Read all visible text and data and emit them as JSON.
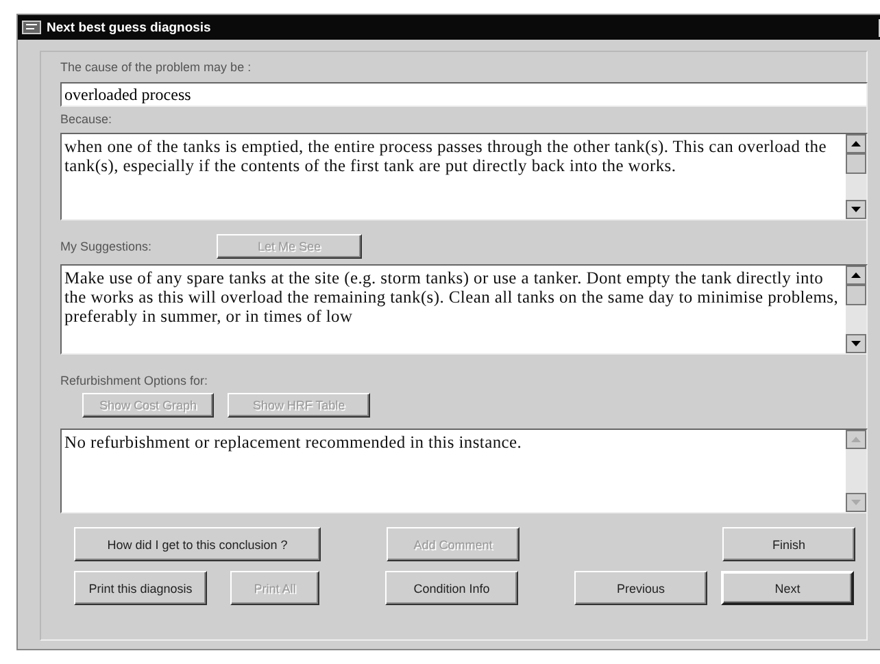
{
  "window": {
    "title": "Next best guess diagnosis"
  },
  "cause": {
    "label": "The cause of the problem may be :",
    "value": "overloaded process"
  },
  "because": {
    "label": "Because:",
    "text": "when one of the tanks is emptied, the entire process passes through the other tank(s). This can overload the tank(s), especially if the contents of the first tank are put directly back into the works.",
    "scroll_disabled": false
  },
  "suggestions": {
    "label": "My Suggestions:",
    "button": {
      "label": "Let Me See",
      "disabled": true
    },
    "text": "Make use of any spare tanks at the site (e.g. storm tanks) or use a tanker. Dont empty the tank directly into the works as this will overload the remaining tank(s). Clean all tanks on the same day to minimise problems, preferably in summer, or in times of low",
    "scroll_disabled": false
  },
  "refurbishment": {
    "label": "Refurbishment Options for:",
    "buttons": [
      {
        "label": "Show Cost Graph",
        "disabled": true
      },
      {
        "label": "Show HRF Table",
        "disabled": true
      }
    ],
    "text": "No refurbishment or replacement recommended in this instance.",
    "scroll_disabled": true
  },
  "buttons_row1": [
    {
      "label": "How did I get to this conclusion ?",
      "disabled": false,
      "default": false
    },
    {
      "label": "Add Comment",
      "disabled": true,
      "default": false
    },
    {
      "label": "Finish",
      "disabled": false,
      "default": false
    }
  ],
  "buttons_row2": [
    {
      "label": "Print this diagnosis",
      "disabled": false,
      "default": false
    },
    {
      "label": "Print All",
      "disabled": true,
      "default": false
    },
    {
      "label": "Condition Info",
      "disabled": false,
      "default": false
    },
    {
      "label": "Previous",
      "disabled": false,
      "default": false
    },
    {
      "label": "Next",
      "disabled": false,
      "default": true
    }
  ]
}
